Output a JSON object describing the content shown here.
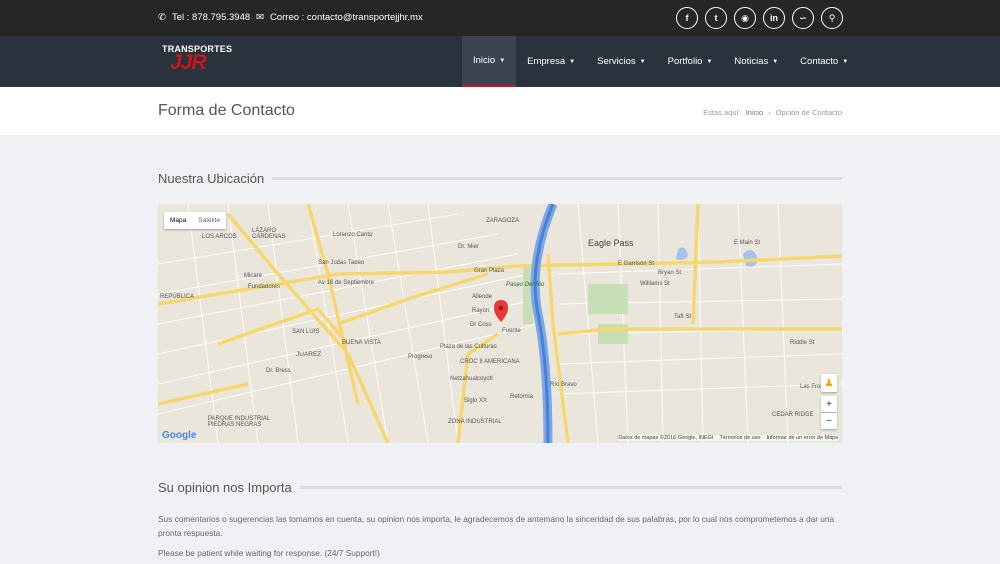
{
  "topbar": {
    "phone": "Tel : 878.795.3948",
    "email": "Correo : contacto@transportejjhr.mx"
  },
  "social_icons": [
    "facebook-icon",
    "twitter-icon",
    "dribbble-icon",
    "linkedin-icon",
    "rss-icon",
    "search-icon"
  ],
  "logo": {
    "line1": "TRANSPORTES",
    "line2": "JJR"
  },
  "menu": [
    {
      "label": "Inicio"
    },
    {
      "label": "Empresa"
    },
    {
      "label": "Servicios"
    },
    {
      "label": "Portfolio"
    },
    {
      "label": "Noticias"
    },
    {
      "label": "Contacto"
    }
  ],
  "page": {
    "title": "Forma de Contacto",
    "breadcrumb_prefix": "Estas aquí:",
    "breadcrumb_home": "Inicio",
    "breadcrumb_sep": "›",
    "breadcrumb_current": "Opción de Contacto"
  },
  "map_section": {
    "title": "Nuestra Ubicación",
    "map_type": [
      "Mapa",
      "Satélite"
    ],
    "attribution": "Datos de mapas ©2016 Google, INEGI",
    "terms": "Términos de uso",
    "report": "Informar de un error de Maps",
    "google": "Google",
    "labels": {
      "eagle_pass": "Eagle Pass",
      "gran_plaza": "Gran Plaza",
      "paseo_rio": "Paseo Del Rio",
      "plaza_culturas": "Plaza de las Culturas",
      "juarez": "JUAREZ",
      "buena_vista": "BUENA VISTA",
      "san_luis": "SAN LUIS",
      "republica": "REPÚBLICA",
      "americana": "AMERICANA",
      "zona_industrial": "ZONA INDUSTRIAL",
      "parque_industrial": "PARQUE INDUSTRIAL PIEDRAS NEGRAS",
      "los_arcos": "LOS ARCOS",
      "lazaro": "LÁZARO CÁRDENAS",
      "zaragoza": "ZARAGOZA",
      "e_main": "E Main St",
      "e_garrison": "E Garrison St",
      "fundadores": "Fundadores",
      "micare": "Micare",
      "allende": "Allende",
      "rayon": "Rayon",
      "fuente": "Fuente",
      "progreso": "Progreso",
      "netzahualcoyotl": "Netzahualcoyotl",
      "siglo": "Siglo XX",
      "reforma": "Reforma",
      "rio_bravo": "Río Bravo",
      "av16": "Av 16 de Septiembre",
      "williams": "Williams St",
      "bryan": "Bryan St",
      "taft": "Taft St",
      "cedar_ridge": "CEDAR RIDGE",
      "riddle": "Riddle St",
      "las_fronteras": "Las Fronteras",
      "lorenzo": "Lorenzo Canto",
      "san_judas": "San Judas Tadeo",
      "dr_mier": "Dr. Mier",
      "dr_coss": "Dr Coss",
      "dr_bress": "Dr. Bress",
      "croc": "CROC II"
    }
  },
  "opinion": {
    "title": "Su opinion nos Importa",
    "p1": "Sus comentarios o sugerencias las tomamos en cuenta, su opinion nos importa, le agradecemos de antemano la sinceridad de sus palabras, por lo cual nos comprometemos a dar una pronta respuesta.",
    "p2": "Please be patient while waiting for response. (24/7 Support!)"
  },
  "colors": {
    "accent": "#d0141b",
    "topbar": "#262626",
    "navbar": "#2a323d"
  }
}
